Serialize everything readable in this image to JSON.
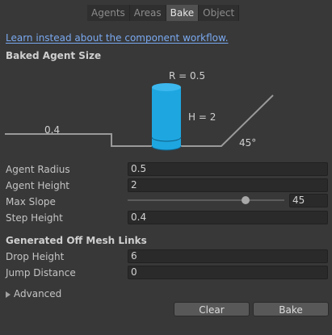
{
  "tabs": [
    {
      "label": "Agents",
      "active": false
    },
    {
      "label": "Areas",
      "active": false
    },
    {
      "label": "Bake",
      "active": true
    },
    {
      "label": "Object",
      "active": false
    }
  ],
  "link_text": "Learn instead about the component workflow.",
  "baked_agent_size": {
    "header": "Baked Agent Size",
    "radius_label": "R = 0.5",
    "height_label": "H = 2",
    "step_label": "0.4",
    "slope_label": "45°"
  },
  "fields": {
    "agent_radius": {
      "label": "Agent Radius",
      "value": "0.5"
    },
    "agent_height": {
      "label": "Agent Height",
      "value": "2"
    },
    "max_slope": {
      "label": "Max Slope",
      "value": "45",
      "fraction": 0.75
    },
    "step_height": {
      "label": "Step Height",
      "value": "0.4"
    }
  },
  "off_mesh_links": {
    "header": "Generated Off Mesh Links",
    "drop_height": {
      "label": "Drop Height",
      "value": "6"
    },
    "jump_distance": {
      "label": "Jump Distance",
      "value": "0"
    }
  },
  "advanced_label": "Advanced",
  "buttons": {
    "clear": "Clear",
    "bake": "Bake"
  },
  "colors": {
    "agent_cylinder": "#1ea6e0",
    "link": "#7aa9f0"
  }
}
